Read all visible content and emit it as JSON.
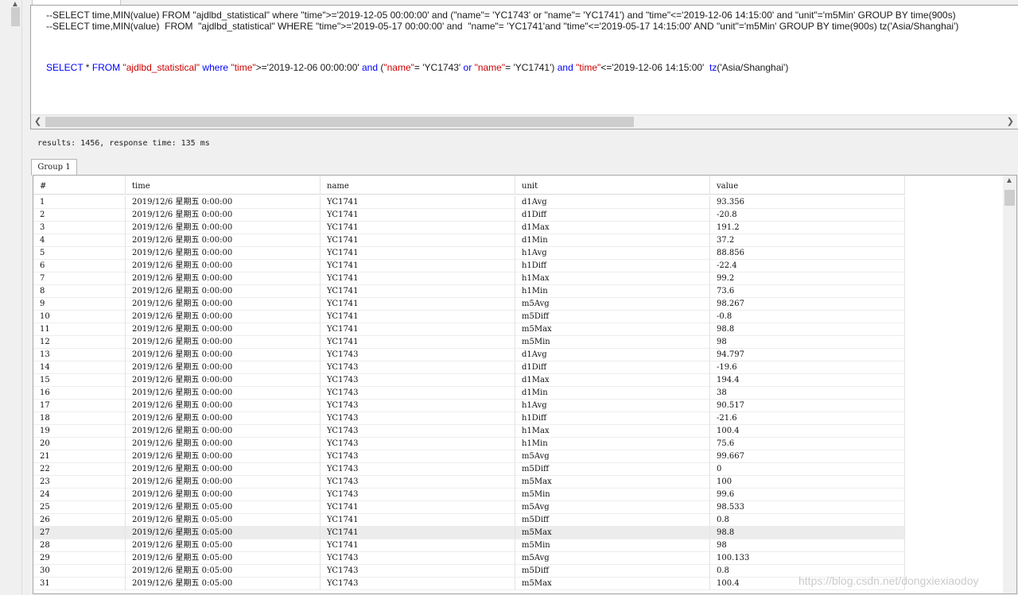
{
  "editor": {
    "lines": [
      [
        {
          "t": "--SELECT time,MIN(value) FROM \"ajdlbd_statistical\" where \"time\">='2019-12-05 00:00:00' and (\"name\"= 'YC1743' or \"name\"= 'YC1741') and \"time\"<='2019-12-06 14:15:00' and \"unit\"='m5Min' GROUP BY time(900s)",
          "c": ""
        }
      ],
      [
        {
          "t": "--SELECT time,MIN(value)  FROM  \"ajdlbd_statistical\" WHERE \"time\">='2019-05-17 00:00:00' and  \"name\"= 'YC1741'and \"time\"<='2019-05-17 14:15:00' AND \"unit\"='m5Min' GROUP BY time(900s) tz('Asia/Shanghai')",
          "c": ""
        }
      ],
      [
        {
          "t": "SELECT",
          "c": "kw"
        },
        {
          "t": " * ",
          "c": ""
        },
        {
          "t": "FROM",
          "c": "kw"
        },
        {
          "t": " ",
          "c": ""
        },
        {
          "t": "\"ajdlbd_statistical\"",
          "c": "str"
        },
        {
          "t": " ",
          "c": ""
        },
        {
          "t": "where",
          "c": "kw"
        },
        {
          "t": " ",
          "c": ""
        },
        {
          "t": "\"time\"",
          "c": "str"
        },
        {
          "t": ">='2019-12-06 00:00:00' ",
          "c": ""
        },
        {
          "t": "and",
          "c": "kw"
        },
        {
          "t": " (",
          "c": ""
        },
        {
          "t": "\"name\"",
          "c": "str"
        },
        {
          "t": "= 'YC1743' ",
          "c": ""
        },
        {
          "t": "or",
          "c": "kw"
        },
        {
          "t": " ",
          "c": ""
        },
        {
          "t": "\"name\"",
          "c": "str"
        },
        {
          "t": "= 'YC1741') ",
          "c": ""
        },
        {
          "t": "and",
          "c": "kw"
        },
        {
          "t": " ",
          "c": ""
        },
        {
          "t": "\"time\"",
          "c": "str"
        },
        {
          "t": "<='2019-12-06 14:15:00'  ",
          "c": ""
        },
        {
          "t": "tz",
          "c": "fn"
        },
        {
          "t": "('Asia/Shanghai')",
          "c": ""
        }
      ]
    ]
  },
  "status": "results: 1456, response time: 135 ms",
  "group_tab": "Group 1",
  "table": {
    "columns": [
      "#",
      "time",
      "name",
      "unit",
      "value"
    ],
    "rows": [
      [
        "1",
        "2019/12/6 星期五 0:00:00",
        "YC1741",
        "d1Avg",
        "93.356"
      ],
      [
        "2",
        "2019/12/6 星期五 0:00:00",
        "YC1741",
        "d1Diff",
        "-20.8"
      ],
      [
        "3",
        "2019/12/6 星期五 0:00:00",
        "YC1741",
        "d1Max",
        "191.2"
      ],
      [
        "4",
        "2019/12/6 星期五 0:00:00",
        "YC1741",
        "d1Min",
        "37.2"
      ],
      [
        "5",
        "2019/12/6 星期五 0:00:00",
        "YC1741",
        "h1Avg",
        "88.856"
      ],
      [
        "6",
        "2019/12/6 星期五 0:00:00",
        "YC1741",
        "h1Diff",
        "-22.4"
      ],
      [
        "7",
        "2019/12/6 星期五 0:00:00",
        "YC1741",
        "h1Max",
        "99.2"
      ],
      [
        "8",
        "2019/12/6 星期五 0:00:00",
        "YC1741",
        "h1Min",
        "73.6"
      ],
      [
        "9",
        "2019/12/6 星期五 0:00:00",
        "YC1741",
        "m5Avg",
        "98.267"
      ],
      [
        "10",
        "2019/12/6 星期五 0:00:00",
        "YC1741",
        "m5Diff",
        "-0.8"
      ],
      [
        "11",
        "2019/12/6 星期五 0:00:00",
        "YC1741",
        "m5Max",
        "98.8"
      ],
      [
        "12",
        "2019/12/6 星期五 0:00:00",
        "YC1741",
        "m5Min",
        "98"
      ],
      [
        "13",
        "2019/12/6 星期五 0:00:00",
        "YC1743",
        "d1Avg",
        "94.797"
      ],
      [
        "14",
        "2019/12/6 星期五 0:00:00",
        "YC1743",
        "d1Diff",
        "-19.6"
      ],
      [
        "15",
        "2019/12/6 星期五 0:00:00",
        "YC1743",
        "d1Max",
        "194.4"
      ],
      [
        "16",
        "2019/12/6 星期五 0:00:00",
        "YC1743",
        "d1Min",
        "38"
      ],
      [
        "17",
        "2019/12/6 星期五 0:00:00",
        "YC1743",
        "h1Avg",
        "90.517"
      ],
      [
        "18",
        "2019/12/6 星期五 0:00:00",
        "YC1743",
        "h1Diff",
        "-21.6"
      ],
      [
        "19",
        "2019/12/6 星期五 0:00:00",
        "YC1743",
        "h1Max",
        "100.4"
      ],
      [
        "20",
        "2019/12/6 星期五 0:00:00",
        "YC1743",
        "h1Min",
        "75.6"
      ],
      [
        "21",
        "2019/12/6 星期五 0:00:00",
        "YC1743",
        "m5Avg",
        "99.667"
      ],
      [
        "22",
        "2019/12/6 星期五 0:00:00",
        "YC1743",
        "m5Diff",
        "0"
      ],
      [
        "23",
        "2019/12/6 星期五 0:00:00",
        "YC1743",
        "m5Max",
        "100"
      ],
      [
        "24",
        "2019/12/6 星期五 0:00:00",
        "YC1743",
        "m5Min",
        "99.6"
      ],
      [
        "25",
        "2019/12/6 星期五 0:05:00",
        "YC1741",
        "m5Avg",
        "98.533"
      ],
      [
        "26",
        "2019/12/6 星期五 0:05:00",
        "YC1741",
        "m5Diff",
        "0.8"
      ],
      [
        "27",
        "2019/12/6 星期五 0:05:00",
        "YC1741",
        "m5Max",
        "98.8"
      ],
      [
        "28",
        "2019/12/6 星期五 0:05:00",
        "YC1741",
        "m5Min",
        "98"
      ],
      [
        "29",
        "2019/12/6 星期五 0:05:00",
        "YC1743",
        "m5Avg",
        "100.133"
      ],
      [
        "30",
        "2019/12/6 星期五 0:05:00",
        "YC1743",
        "m5Diff",
        "0.8"
      ],
      [
        "31",
        "2019/12/6 星期五 0:05:00",
        "YC1743",
        "m5Max",
        "100.4"
      ]
    ],
    "highlighted_row": 27
  },
  "watermark": "https://blog.csdn.net/dongxiexiaodoy"
}
